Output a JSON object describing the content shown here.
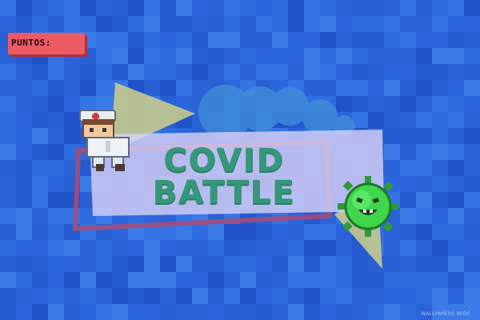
{
  "hud": {
    "score_label": "PUNTOS:"
  },
  "logo": {
    "title_line_1": "COVID",
    "title_line_2": "BATTLE"
  },
  "colors": {
    "background": "#2a63d8",
    "score_box": "#ec5a63",
    "title_text": "#35987a",
    "banner": "#c9c3f0",
    "banner_border": "#b24a6e",
    "triangle": "#cfd08a",
    "virus": "#3fd64a"
  },
  "icons": {
    "player": "nurse-character-icon",
    "enemy": "virus-enemy-icon"
  },
  "watermark": "WALLPAPERS WIDE"
}
